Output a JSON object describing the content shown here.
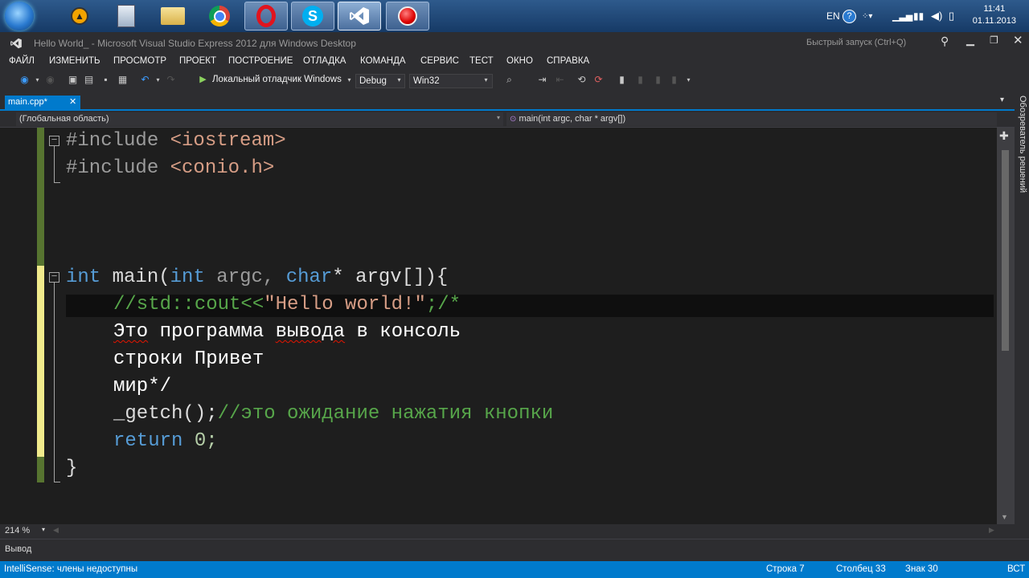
{
  "taskbar": {
    "apps": [
      {
        "name": "aimp",
        "icon": "aimp-icon"
      },
      {
        "name": "calculator",
        "icon": "calculator-icon"
      },
      {
        "name": "explorer",
        "icon": "folder-icon"
      },
      {
        "name": "chrome",
        "icon": "chrome-icon"
      },
      {
        "name": "opera",
        "icon": "opera-icon"
      },
      {
        "name": "skype",
        "icon": "skype-icon"
      },
      {
        "name": "visual-studio",
        "icon": "visual-studio-icon"
      },
      {
        "name": "recorder",
        "icon": "record-icon"
      }
    ],
    "language": "EN",
    "time": "11:41",
    "date": "01.11.2013"
  },
  "window": {
    "title": "Hello World_ - Microsoft Visual Studio Express 2012 для Windows Desktop",
    "quick_launch_placeholder": "Быстрый запуск (Ctrl+Q)"
  },
  "menu": [
    "ФАЙЛ",
    "ИЗМЕНИТЬ",
    "ПРОСМОТР",
    "ПРОЕКТ",
    "ПОСТРОЕНИЕ",
    "ОТЛАДКА",
    "КОМАНДА",
    "СЕРВИС",
    "ТЕСТ",
    "ОКНО",
    "СПРАВКА"
  ],
  "toolbar": {
    "debugger_label": "Локальный отладчик Windows",
    "configuration": "Debug",
    "platform": "Win32"
  },
  "tab": {
    "label": "main.cpp*"
  },
  "nav": {
    "scope": "(Глобальная область)",
    "member": "main(int argc, char * argv[])"
  },
  "code": {
    "line1_directive": "#include",
    "line1_header": "<iostream>",
    "line2_directive": "#include",
    "line2_header": "<conio.h>",
    "main_int": "int",
    "main_name": " main(",
    "main_int2": "int",
    "main_argc": " argc, ",
    "main_char": "char",
    "main_rest": "* argv[]){",
    "c1_pre": "//std::cout<<",
    "c1_str": "\"Hello world!\"",
    "c1_post": ";/*",
    "c2_w1": "Это",
    "c2_w2": "программа",
    "c2_w3": "вывода",
    "c2_w4": "в консоль",
    "c3": "строки Привет",
    "c4": "мир*/",
    "getch_call": "_getch();",
    "getch_comment": "//это ожидание нажатия кнопки",
    "ret_kw": "return",
    "ret_val": " 0;",
    "close_brace": "}"
  },
  "side_panel_label": "Обозреватель решений",
  "zoom": "214 %",
  "output_label": "Вывод",
  "status": {
    "message": "IntelliSense: члены недоступны",
    "line": "Строка 7",
    "column": "Столбец 33",
    "char": "Знак 30",
    "mode": "ВСТ"
  },
  "colors": {
    "accent": "#007acc",
    "keyword": "#569cd6",
    "string": "#d69d85",
    "comment": "#57a64a",
    "changed": "#f0ea8c",
    "saved": "#577430"
  }
}
